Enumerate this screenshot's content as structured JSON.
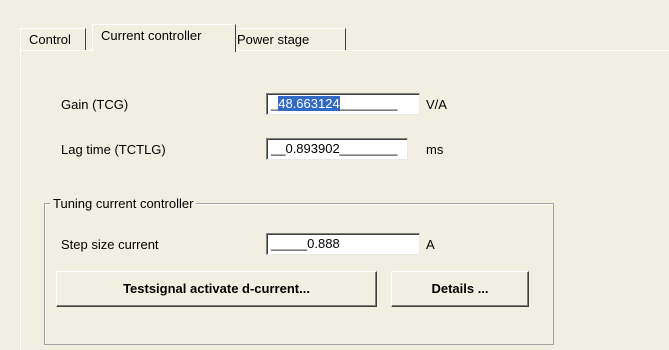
{
  "tabs": [
    {
      "label": "Control",
      "active": false
    },
    {
      "label": "Current controller",
      "active": true
    },
    {
      "label": "Power stage",
      "active": false
    }
  ],
  "fields": {
    "gain": {
      "label": "Gain (TCG)",
      "value_prefix": "_",
      "value_selected": "48.663124",
      "value_suffix": "________",
      "unit": "V/A"
    },
    "lag_time": {
      "label": "Lag time (TCTLG)",
      "value": "__0.893902________",
      "unit": "ms"
    }
  },
  "tuning": {
    "title": "Tuning current controller",
    "step_size": {
      "label": "Step size current",
      "value": "_____0.888",
      "unit": "A"
    },
    "testsignal_button": "Testsignal activate d-current...",
    "details_button": "Details ..."
  },
  "colors": {
    "background": "#f1efe2",
    "selection": "#316ac5"
  }
}
